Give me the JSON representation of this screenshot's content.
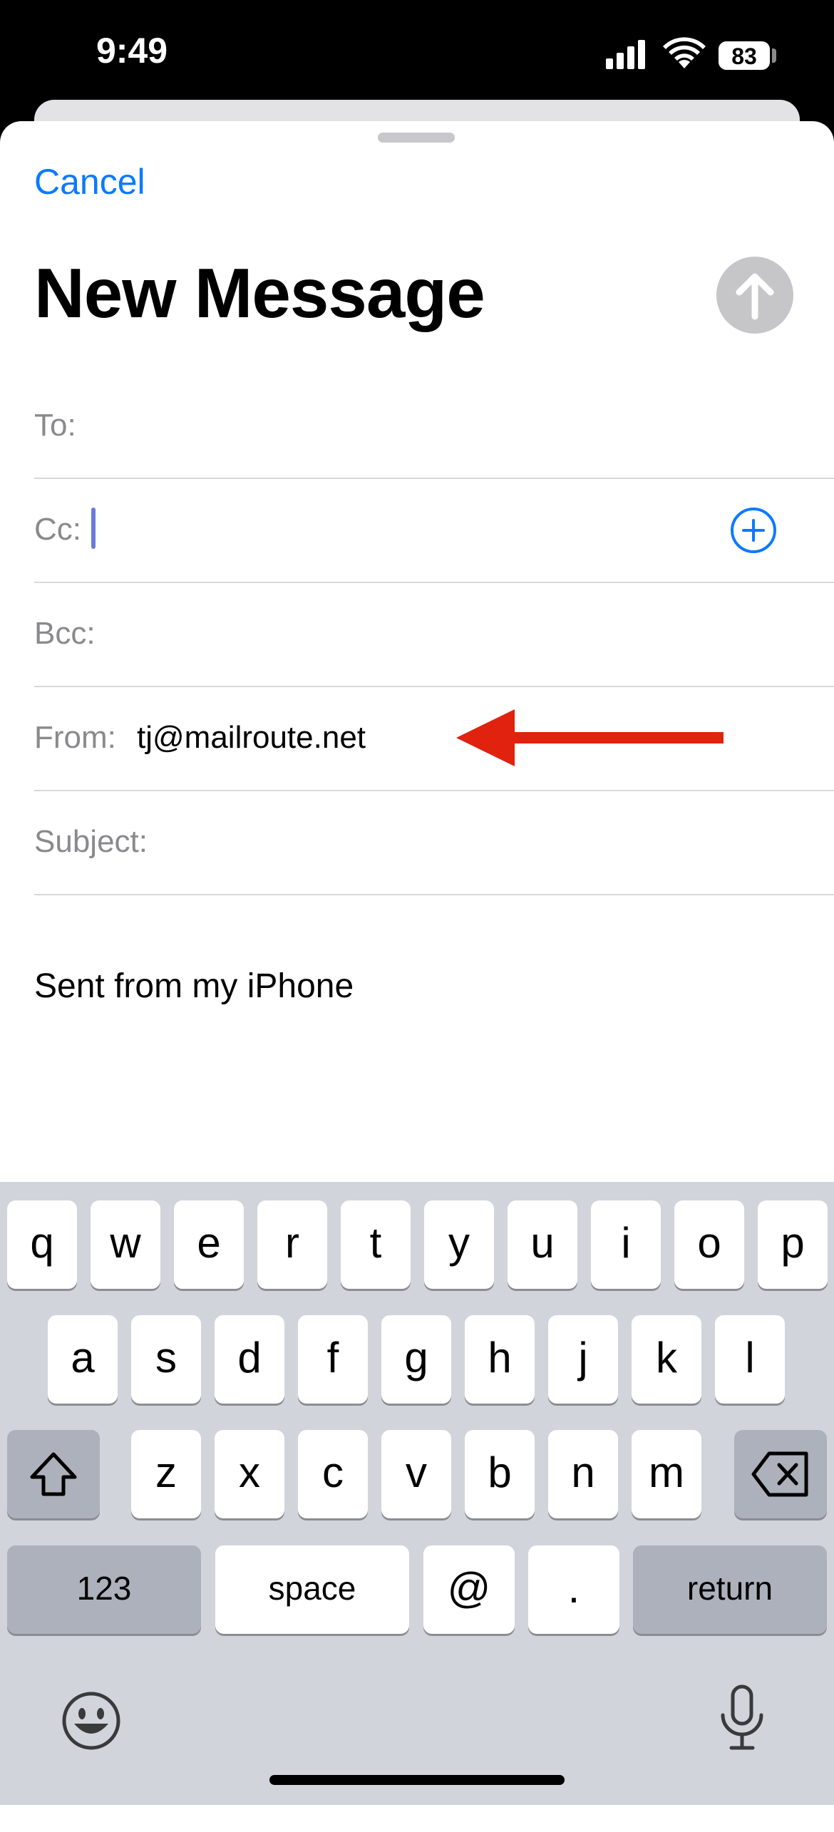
{
  "status_bar": {
    "time": "9:49",
    "battery": "83"
  },
  "compose": {
    "cancel_label": "Cancel",
    "title": "New Message",
    "fields": {
      "to_label": "To:",
      "cc_label": "Cc:",
      "bcc_label": "Bcc:",
      "from_label": "From:",
      "from_value": "tj@mailroute.net",
      "subject_label": "Subject:"
    },
    "signature": "Sent from my iPhone"
  },
  "annotation": {
    "arrow_color": "#e0220f"
  },
  "colors": {
    "accent": "#0a7aff",
    "send_disabled": "#c6c6c8",
    "keyboard_bg": "#d1d4db"
  },
  "keyboard": {
    "row1": [
      "q",
      "w",
      "e",
      "r",
      "t",
      "y",
      "u",
      "i",
      "o",
      "p"
    ],
    "row2": [
      "a",
      "s",
      "d",
      "f",
      "g",
      "h",
      "j",
      "k",
      "l"
    ],
    "row3": [
      "z",
      "x",
      "c",
      "v",
      "b",
      "n",
      "m"
    ],
    "numbers_label": "123",
    "space_label": "space",
    "at_label": "@",
    "period_label": ".",
    "return_label": "return",
    "icons": [
      "shift-icon",
      "delete-icon",
      "emoji-icon",
      "microphone-icon"
    ]
  }
}
